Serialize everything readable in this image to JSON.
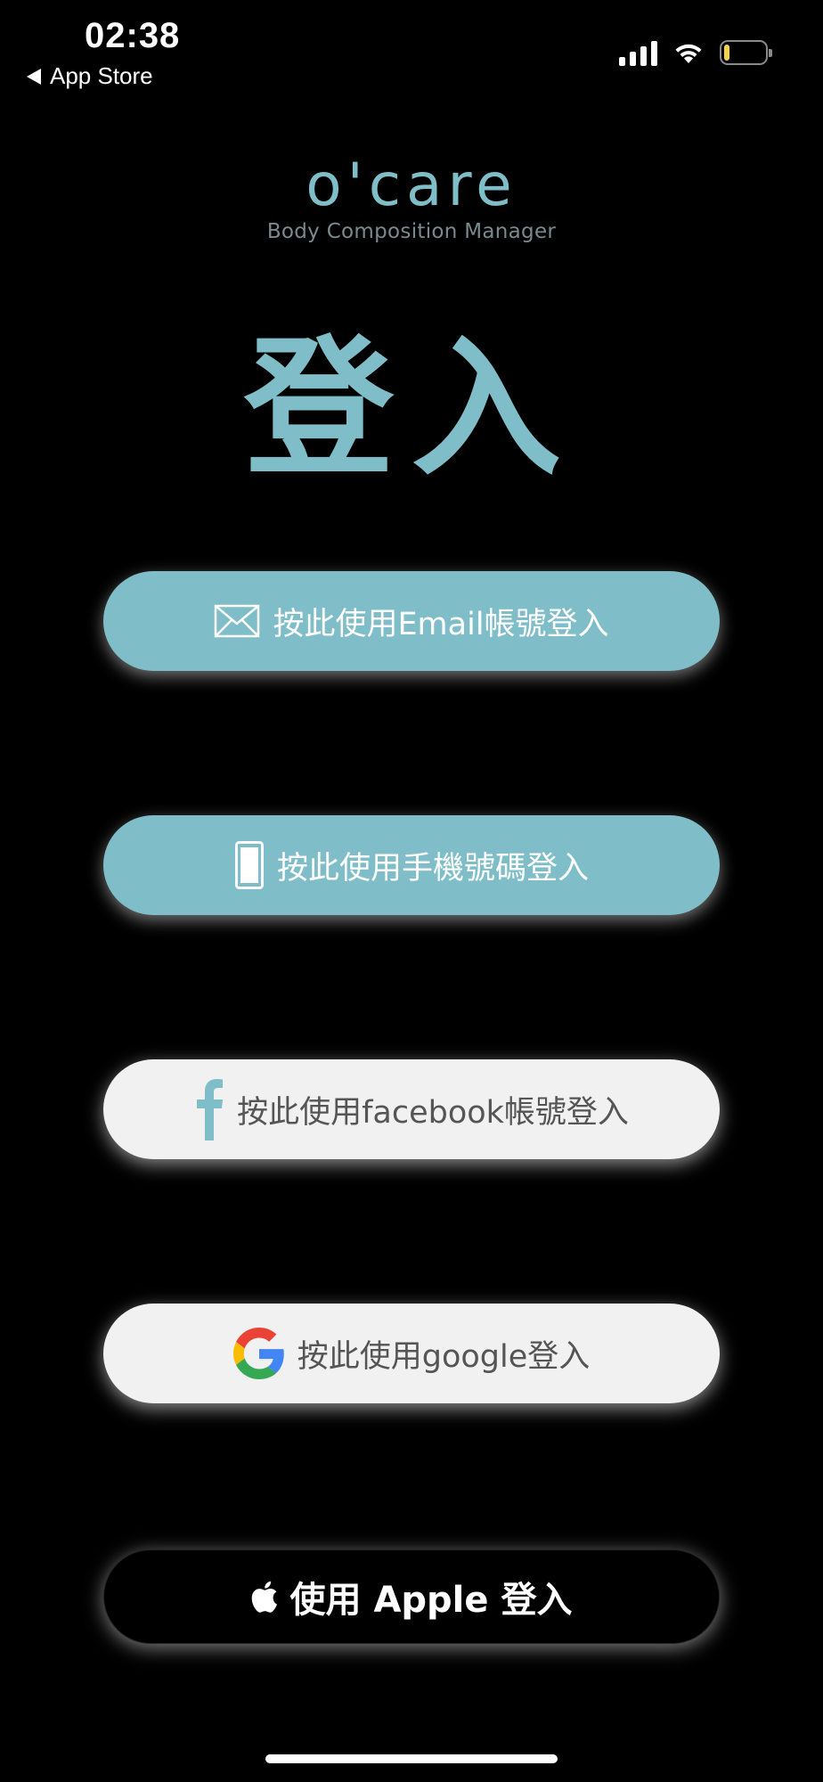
{
  "status_bar": {
    "time": "02:38",
    "back_label": "App Store",
    "battery_level": 0.15
  },
  "brand": {
    "logo_text": "o'care",
    "tagline": "Body Composition Manager"
  },
  "page_title": "登入",
  "buttons": {
    "email": {
      "label": "按此使用Email帳號登入",
      "icon": "envelope-icon"
    },
    "phone": {
      "label": "按此使用手機號碼登入",
      "icon": "phone-icon"
    },
    "facebook": {
      "label": "按此使用facebook帳號登入",
      "icon": "facebook-icon"
    },
    "google": {
      "label": "按此使用google登入",
      "icon": "google-icon"
    },
    "apple": {
      "label": "使用 Apple 登入",
      "icon": "apple-icon"
    }
  },
  "colors": {
    "accent": "#7fbec8",
    "background": "#000000",
    "light_button": "#f1f1f1"
  }
}
